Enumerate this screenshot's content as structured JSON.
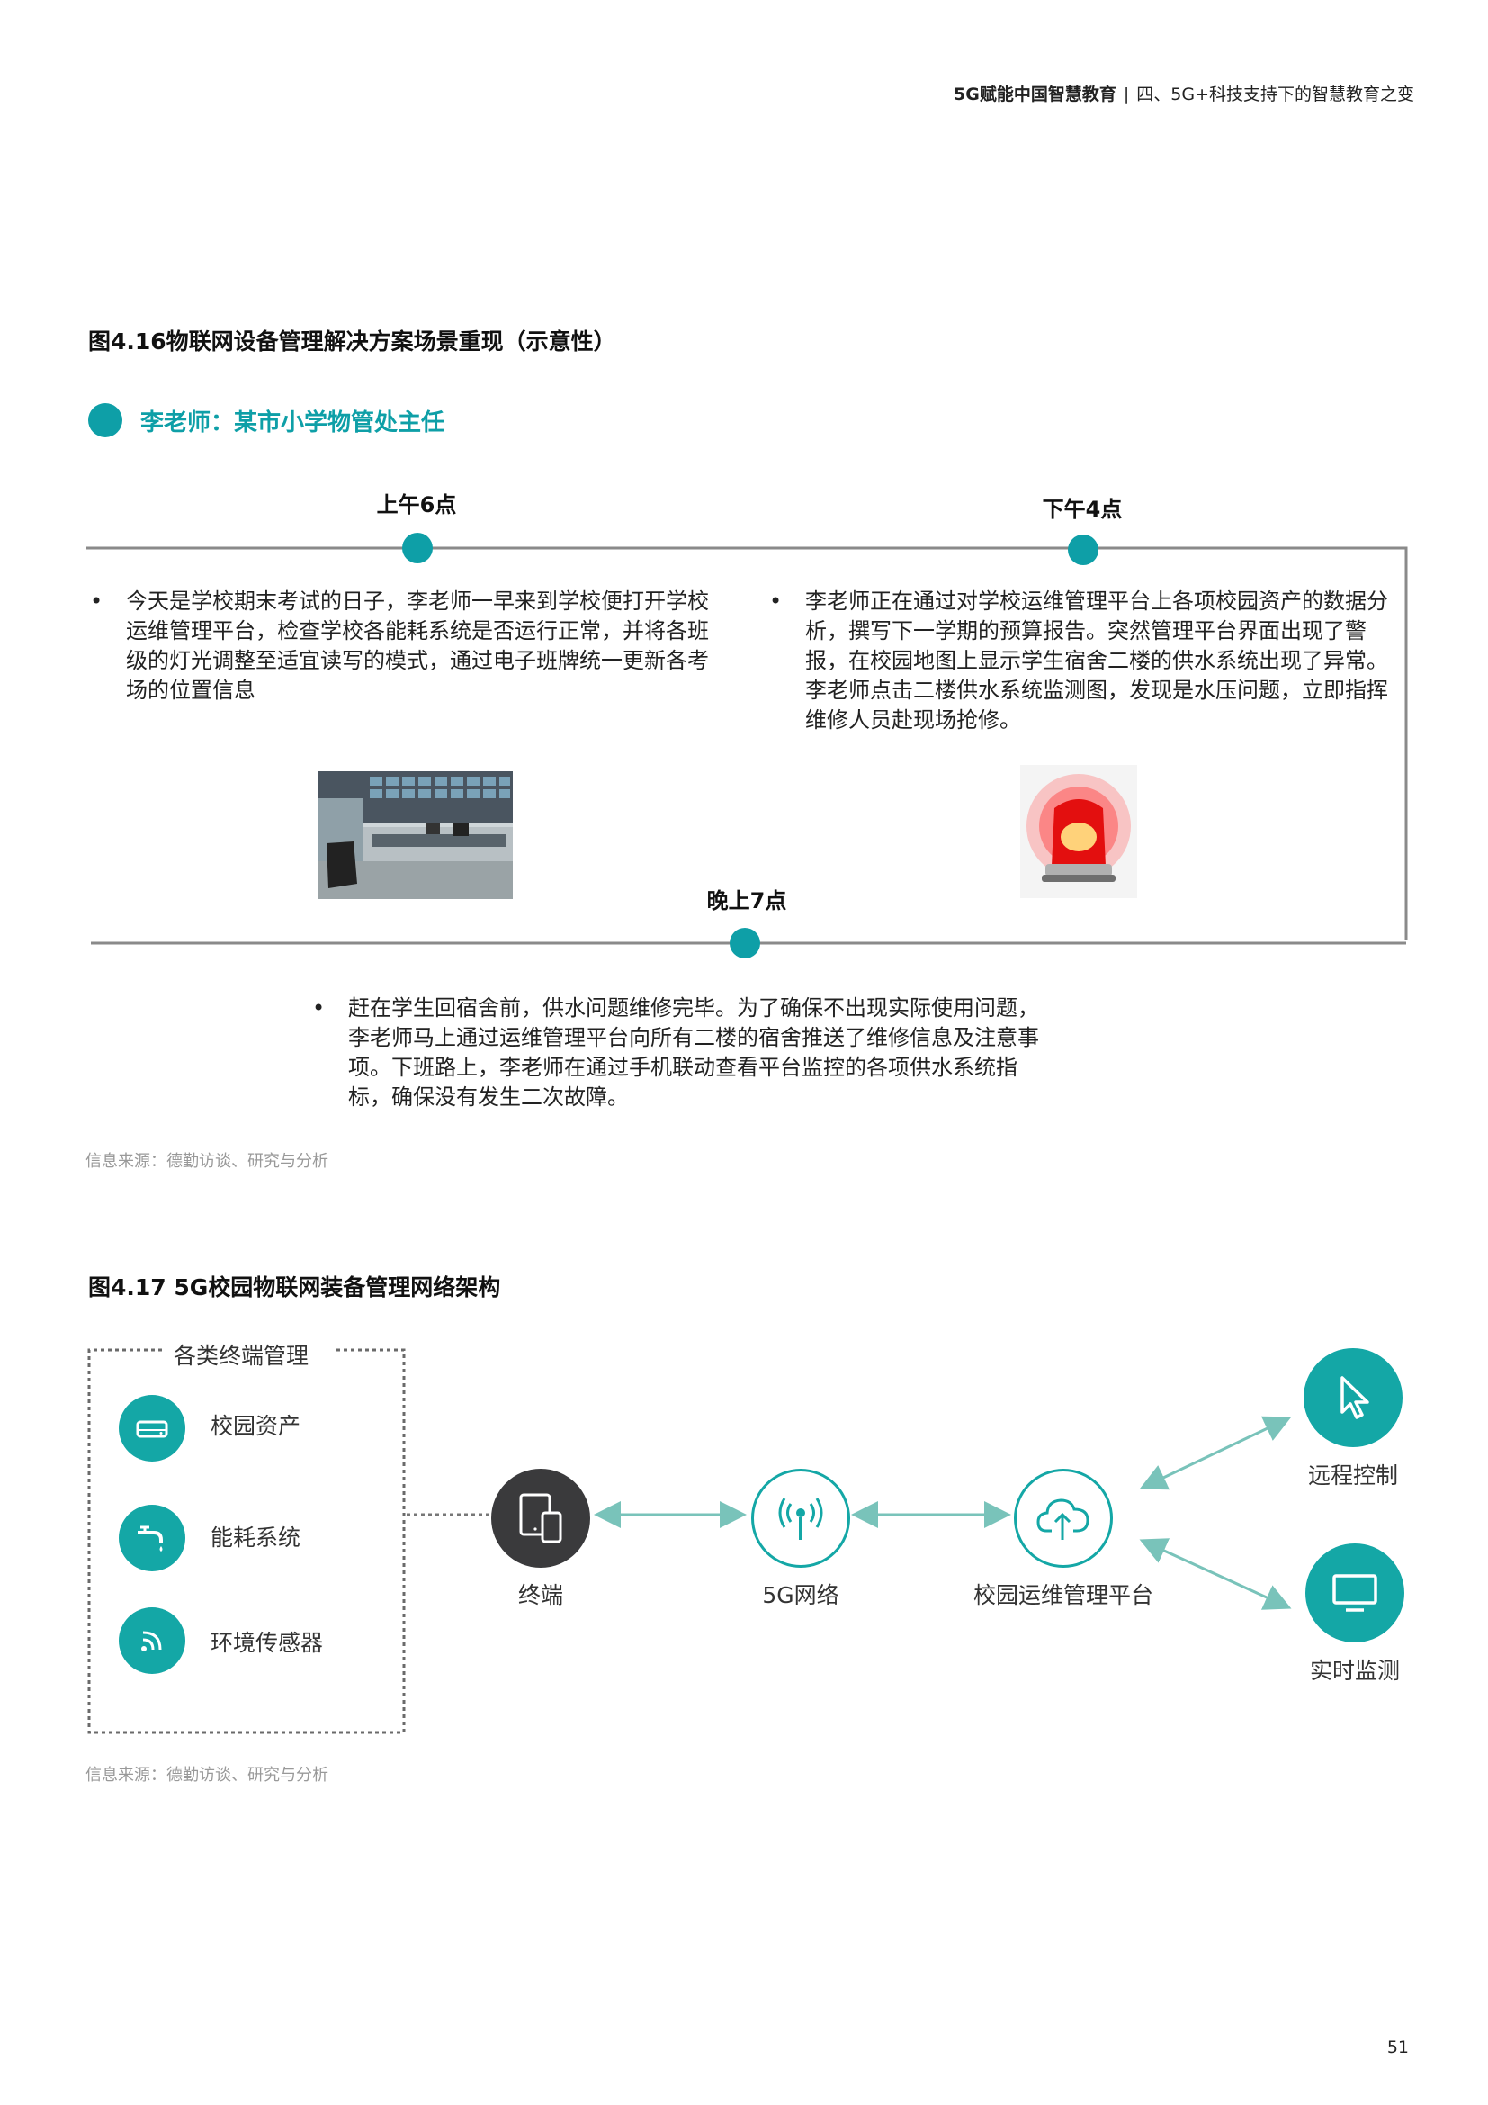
{
  "header": {
    "doc_title": "5G赋能中国智慧教育",
    "separator": "|",
    "section": "四、5G+科技支持下的智慧教育之变"
  },
  "figure1": {
    "title": "图4.16物联网设备管理解决方案场景重现（示意性）",
    "persona": "李老师：某市小学物管处主任",
    "events": [
      {
        "time": "上午6点",
        "text": "今天是学校期末考试的日子，李老师一早来到学校便打开学校运维管理平台，检查学校各能耗系统是否运行正常，并将各班级的灯光调整至适宜读写的模式，通过电子班牌统一更新各考场的位置信息"
      },
      {
        "time": "下午4点",
        "text": "李老师正在通过对学校运维管理平台上各项校园资产的数据分析，撰写下一学期的预算报告。突然管理平台界面出现了警报，在校园地图上显示学生宿舍二楼的供水系统出现了异常。李老师点击二楼供水系统监测图，发现是水压问题，立即指挥维修人员赴现场抢修。"
      },
      {
        "time": "晚上7点",
        "text": "赶在学生回宿舍前，供水问题维修完毕。为了确保不出现实际使用问题，李老师马上通过运维管理平台向所有二楼的宿舍推送了维修信息及注意事项。下班路上，李老师在通过手机联动查看平台监控的各项供水系统指标，确保没有发生二次故障。"
      }
    ],
    "bullet": "•",
    "source": "信息来源：德勤访谈、研究与分析"
  },
  "figure2": {
    "title": "图4.17 5G校园物联网装备管理网络架构",
    "group_title": "各类终端管理",
    "devices": [
      {
        "label": "校园资产",
        "icon": "storage-icon"
      },
      {
        "label": "能耗系统",
        "icon": "faucet-icon"
      },
      {
        "label": "环境传感器",
        "icon": "signal-icon"
      }
    ],
    "nodes": [
      {
        "label": "终端",
        "icon": "tablet-icon"
      },
      {
        "label": "5G网络",
        "icon": "antenna-icon"
      },
      {
        "label": "校园运维管理平台",
        "icon": "cloud-upload-icon"
      }
    ],
    "outputs": [
      {
        "label": "远程控制",
        "icon": "cursor-icon"
      },
      {
        "label": "实时监测",
        "icon": "monitor-icon"
      }
    ],
    "source": "信息来源：德勤访谈、研究与分析"
  },
  "page_number": "51",
  "colors": {
    "accent": "#0e9fa7",
    "arrow": "#79c3ba",
    "dark_node": "#3a3a3c"
  }
}
